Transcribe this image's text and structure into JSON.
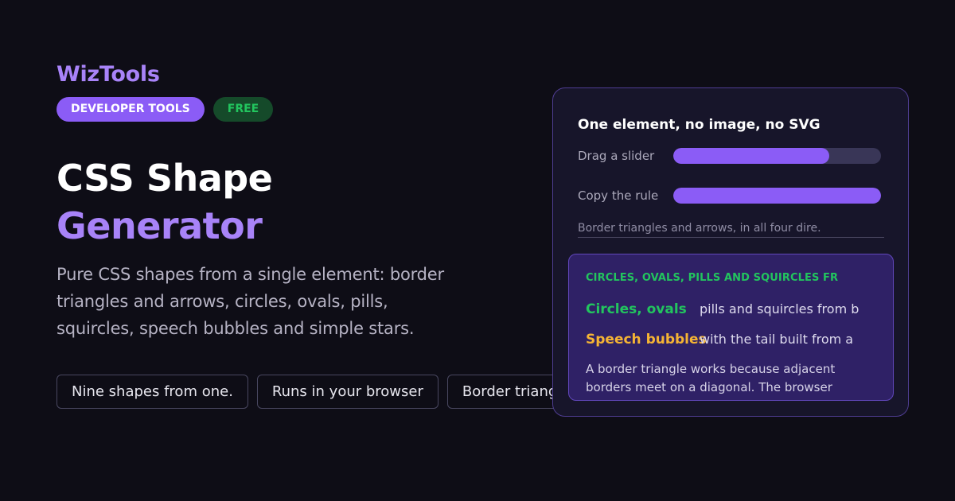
{
  "brand": "WizTools",
  "badges": {
    "category": "DEVELOPER TOOLS",
    "price": "FREE"
  },
  "title": {
    "line1": "CSS Shape",
    "line2": "Generator"
  },
  "description": "Pure CSS shapes from a single element: border triangles and arrows, circles, ovals, pills, squircles, speech bubbles and simple stars.",
  "chips": [
    "Nine shapes from one.",
    "Runs in your browser",
    "Border triangl"
  ],
  "panel": {
    "heading": "One element, no image, no SVG",
    "sliders": [
      {
        "label": "Drag a slider",
        "level_percent": 75
      },
      {
        "label": "Copy the rule",
        "level_percent": 100
      }
    ],
    "note": "Border triangles and arrows, in all four dire.",
    "inner": {
      "heading": "CIRCLES, OVALS, PILLS AND SQUIRCLES FR",
      "features": [
        {
          "name": "Circles, ovals",
          "text": "pills and squircles from b"
        },
        {
          "name": "Speech bubbles",
          "text": "with the tail built from a"
        }
      ],
      "paragraph": "A border triangle works because adjacent borders meet on a diagonal. The browser"
    }
  },
  "colors": {
    "background": "#0e0d16",
    "accent": "#a883f8",
    "badge_primary": "#8b5cf6",
    "badge_free_bg": "#154a2a",
    "badge_free_text": "#22c55e",
    "panel_bg": "#17152a",
    "inner_bg": "#2f2166",
    "highlight_green": "#22c55e",
    "highlight_yellow": "#f5b434"
  }
}
